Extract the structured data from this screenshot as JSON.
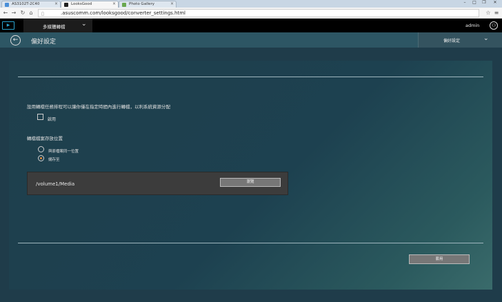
{
  "browser": {
    "tabs": [
      {
        "title": "AS3102T-2C40",
        "fav_color": "#4a8fd8",
        "active": false
      },
      {
        "title": "LooksGood",
        "fav_color": "#222222",
        "active": true
      },
      {
        "title": "Photo Gallery",
        "fav_color": "#6aa84f",
        "active": false
      }
    ],
    "close_glyph": "×",
    "url": ".asuscomm.com/looksgood/converter_settings.html"
  },
  "app_header": {
    "menu_label": "多媒體轉檔",
    "user": "admin"
  },
  "sub_header": {
    "page_title": "偏好設定",
    "settings_dropdown": "偏好設定"
  },
  "form": {
    "schedule_desc": "設用轉檔任務排程可以讓你僅在指定時間內進行轉檔，以利系統資源分配",
    "enable_label": "啟用",
    "enable_checked": false,
    "location_heading": "轉檔檔案存放位置",
    "radio_options": [
      {
        "label": "與原檔案同一位置",
        "selected": false
      },
      {
        "label": "儲存至",
        "selected": true
      }
    ],
    "path_value": "/volume1/Media",
    "browse_label": "瀏覽",
    "apply_label": "套用"
  },
  "colors": {
    "accent_radio": "#e08a3a",
    "header_bg": "#000000",
    "subheader_bg": "#2d5664"
  }
}
